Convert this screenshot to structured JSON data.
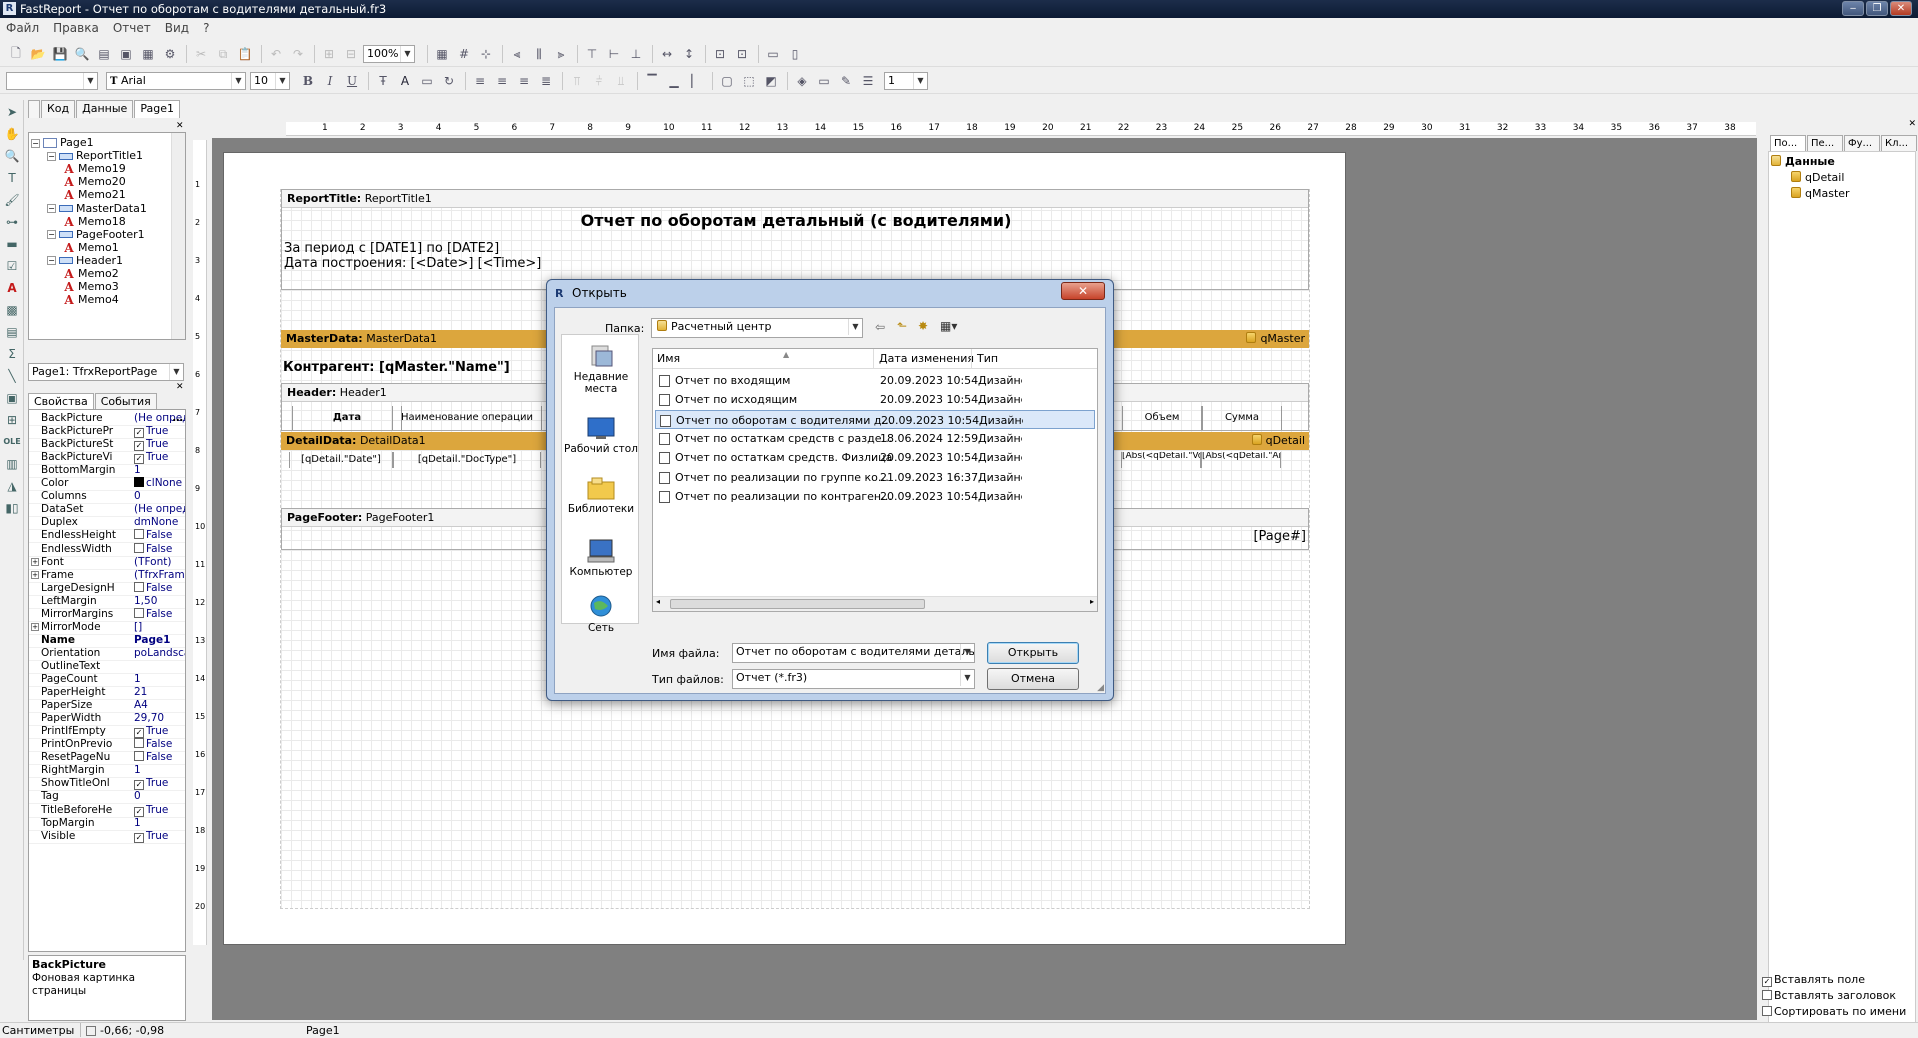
{
  "window": {
    "title": "FastReport - Отчет по оборотам с водителями детальный.fr3"
  },
  "menu": [
    "Файл",
    "Правка",
    "Отчет",
    "Вид",
    "?"
  ],
  "toolbar": {
    "zoom": "100%",
    "font_name": "Arial",
    "font_size": "10",
    "line_width": "1",
    "style_box": ""
  },
  "left_tabs": [
    "Код",
    "Данные",
    "Page1"
  ],
  "tree": {
    "nodes": [
      {
        "label": "Page1",
        "kind": "page"
      },
      {
        "label": "ReportTitle1",
        "kind": "band"
      },
      {
        "label": "Memo19",
        "kind": "memo"
      },
      {
        "label": "Memo20",
        "kind": "memo"
      },
      {
        "label": "Memo21",
        "kind": "memo"
      },
      {
        "label": "MasterData1",
        "kind": "band"
      },
      {
        "label": "Memo18",
        "kind": "memo"
      },
      {
        "label": "PageFooter1",
        "kind": "band"
      },
      {
        "label": "Memo1",
        "kind": "memo"
      },
      {
        "label": "Header1",
        "kind": "band"
      },
      {
        "label": "Memo2",
        "kind": "memo"
      },
      {
        "label": "Memo3",
        "kind": "memo"
      },
      {
        "label": "Memo4",
        "kind": "memo"
      }
    ]
  },
  "object_selector": "Page1: TfrxReportPage",
  "prop_tabs": [
    "Свойства",
    "События"
  ],
  "properties": [
    {
      "name": "BackPicture",
      "value": "(Не определен)",
      "type": "text"
    },
    {
      "name": "BackPicturePr",
      "value": "True",
      "type": "check",
      "checked": true
    },
    {
      "name": "BackPictureSt",
      "value": "True",
      "type": "check",
      "checked": true
    },
    {
      "name": "BackPictureVi",
      "value": "True",
      "type": "check",
      "checked": true
    },
    {
      "name": "BottomMargin",
      "value": "1",
      "type": "text"
    },
    {
      "name": "Color",
      "value": "clNone",
      "type": "color"
    },
    {
      "name": "Columns",
      "value": "0",
      "type": "text"
    },
    {
      "name": "DataSet",
      "value": "(Не определен)",
      "type": "text"
    },
    {
      "name": "Duplex",
      "value": "dmNone",
      "type": "text"
    },
    {
      "name": "EndlessHeight",
      "value": "False",
      "type": "check",
      "checked": false
    },
    {
      "name": "EndlessWidth",
      "value": "False",
      "type": "check",
      "checked": false
    },
    {
      "name": "Font",
      "value": "(TFont)",
      "type": "expand"
    },
    {
      "name": "Frame",
      "value": "(TfrxFrame)",
      "type": "expand"
    },
    {
      "name": "LargeDesignH",
      "value": "False",
      "type": "check",
      "checked": false
    },
    {
      "name": "LeftMargin",
      "value": "1,50",
      "type": "text"
    },
    {
      "name": "MirrorMargins",
      "value": "False",
      "type": "check",
      "checked": false
    },
    {
      "name": "MirrorMode",
      "value": "[]",
      "type": "expand"
    },
    {
      "name": "Name",
      "value": "Page1",
      "type": "bold"
    },
    {
      "name": "Orientation",
      "value": "poLandscape",
      "type": "text"
    },
    {
      "name": "OutlineText",
      "value": "",
      "type": "text"
    },
    {
      "name": "PageCount",
      "value": "1",
      "type": "text"
    },
    {
      "name": "PaperHeight",
      "value": "21",
      "type": "text"
    },
    {
      "name": "PaperSize",
      "value": "A4",
      "type": "text"
    },
    {
      "name": "PaperWidth",
      "value": "29,70",
      "type": "text"
    },
    {
      "name": "PrintIfEmpty",
      "value": "True",
      "type": "check",
      "checked": true
    },
    {
      "name": "PrintOnPrevio",
      "value": "False",
      "type": "check",
      "checked": false
    },
    {
      "name": "ResetPageNu",
      "value": "False",
      "type": "check",
      "checked": false
    },
    {
      "name": "RightMargin",
      "value": "1",
      "type": "text"
    },
    {
      "name": "ShowTitleOnl",
      "value": "True",
      "type": "check",
      "checked": true
    },
    {
      "name": "Tag",
      "value": "0",
      "type": "text"
    },
    {
      "name": "TitleBeforeHe",
      "value": "True",
      "type": "check",
      "checked": true
    },
    {
      "name": "TopMargin",
      "value": "1",
      "type": "text"
    },
    {
      "name": "Visible",
      "value": "True",
      "type": "check",
      "checked": true
    }
  ],
  "hint": {
    "title": "BackPicture",
    "text": "Фоновая картинка страницы"
  },
  "status": {
    "units": "Сантиметры",
    "coords": "-0,66; -0,98",
    "page": "Page1"
  },
  "ruler_numbers": [
    "1",
    "2",
    "3",
    "4",
    "5",
    "6",
    "7",
    "8",
    "9",
    "10",
    "11",
    "12",
    "13",
    "14",
    "15",
    "16",
    "17",
    "18",
    "19",
    "20",
    "21",
    "22",
    "23",
    "24",
    "25",
    "26",
    "27",
    "28",
    "29",
    "30",
    "31",
    "32",
    "33",
    "34",
    "35",
    "36",
    "37",
    "38"
  ],
  "vruler_numbers": [
    "1",
    "2",
    "3",
    "4",
    "5",
    "6",
    "7",
    "8",
    "9",
    "10",
    "11",
    "12",
    "13",
    "14",
    "15",
    "16",
    "17",
    "18",
    "19",
    "20"
  ],
  "report": {
    "report_title_band": {
      "kind": "ReportTitle:",
      "name": "ReportTitle1"
    },
    "title": "Отчет по оборотам детальный (с водителями)",
    "period": "За период с [DATE1] по [DATE2]",
    "built": "Дата построения: [<Date>] [<Time>]",
    "master_band": {
      "kind": "MasterData:",
      "name": "MasterData1",
      "dataset": "qMaster"
    },
    "contragent": "Контрагент: [qMaster.\"Name\"]",
    "header_band": {
      "kind": "Header:",
      "name": "Header1"
    },
    "header_cells": [
      "Дата",
      "Наименование операции",
      "Объем",
      "Сумма"
    ],
    "detail_band": {
      "kind": "DetailData:",
      "name": "DetailData1",
      "dataset": "qDetail"
    },
    "detail_cells": [
      "[qDetail.\"Date\"]",
      "[qDetail.\"DocType\"]",
      "[Abs(<qDetail.\"Volume\">)]",
      "[Abs(<qDetail.\"Amount\">)]"
    ],
    "footer_band": {
      "kind": "PageFooter:",
      "name": "PageFooter1"
    },
    "page_number": "[Page#]"
  },
  "right_panel": {
    "tabs": [
      "По...",
      "Пе...",
      "Фу...",
      "Кл..."
    ],
    "tree_root": "Данные",
    "datasets": [
      "qDetail",
      "qMaster"
    ],
    "checks": [
      {
        "label": "Вставлять поле",
        "checked": true
      },
      {
        "label": "Вставлять заголовок",
        "checked": false
      },
      {
        "label": "Сортировать по имени",
        "checked": false
      }
    ]
  },
  "dialog": {
    "title": "Открыть",
    "folder_label": "Папка:",
    "folder": "Расчетный центр",
    "places": [
      "Недавние места",
      "Рабочий стол",
      "Библиотеки",
      "Компьютер",
      "Сеть"
    ],
    "columns": [
      "Имя",
      "Дата изменения",
      "Тип"
    ],
    "files": [
      {
        "name": "Отчет по входящим",
        "date": "20.09.2023 10:54",
        "type": "Дизайнер"
      },
      {
        "name": "Отчет по исходящим",
        "date": "20.09.2023 10:54",
        "type": "Дизайнер"
      },
      {
        "name": "Отчет по оборотам с водителями детальн...",
        "date": "20.09.2023 10:54",
        "type": "Дизайнер"
      },
      {
        "name": "Отчет по остаткам средств с раздельным ...",
        "date": "18.06.2024 12:59",
        "type": "Дизайнер"
      },
      {
        "name": "Отчет по остаткам средств. Физлица",
        "date": "20.09.2023 10:54",
        "type": "Дизайнер"
      },
      {
        "name": "Отчет по реализации по группе контраге...",
        "date": "21.09.2023 16:37",
        "type": "Дизайнер"
      },
      {
        "name": "Отчет по реализации по контрагенту дета...",
        "date": "20.09.2023 10:54",
        "type": "Дизайнер"
      }
    ],
    "selected_index": 2,
    "filename_label": "Имя файла:",
    "filename": "Отчет по оборотам с водителями детальный",
    "filetype_label": "Тип файлов:",
    "filetype": "Отчет (*.fr3)",
    "open_button": "Открыть",
    "cancel_button": "Отмена"
  }
}
